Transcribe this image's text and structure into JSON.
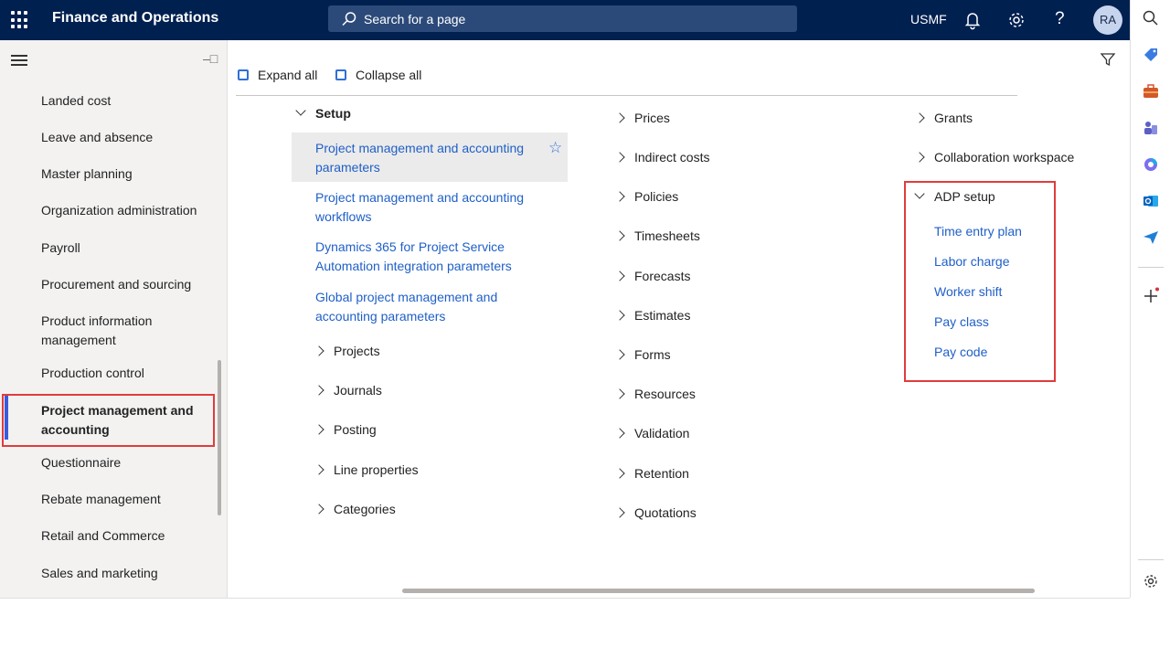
{
  "header": {
    "app_title": "Finance and Operations",
    "search_placeholder": "Search for a page",
    "company": "USMF",
    "avatar_initials": "RA",
    "help_label": "?"
  },
  "sidebar": {
    "items": [
      {
        "label": "Landed cost"
      },
      {
        "label": "Leave and absence"
      },
      {
        "label": "Master planning"
      },
      {
        "label": "Organization administration"
      },
      {
        "label": "Payroll"
      },
      {
        "label": "Procurement and sourcing"
      },
      {
        "label": "Product information management"
      },
      {
        "label": "Production control"
      },
      {
        "label": "Project management and accounting"
      },
      {
        "label": "Questionnaire"
      },
      {
        "label": "Rebate management"
      },
      {
        "label": "Retail and Commerce"
      },
      {
        "label": "Sales and marketing"
      }
    ],
    "active_item": "Project management and accounting"
  },
  "toolbar": {
    "expand_all": "Expand all",
    "collapse_all": "Collapse all"
  },
  "col1": {
    "setup_heading": "Setup",
    "setup_links": [
      {
        "label": "Project management and accounting parameters"
      },
      {
        "label": "Project management and accounting workflows"
      },
      {
        "label": "Dynamics 365 for Project Service Automation integration parameters"
      },
      {
        "label": "Global project management and accounting parameters"
      }
    ],
    "groups": [
      {
        "label": "Projects"
      },
      {
        "label": "Journals"
      },
      {
        "label": "Posting"
      },
      {
        "label": "Line properties"
      },
      {
        "label": "Categories"
      }
    ]
  },
  "col2": {
    "groups": [
      {
        "label": "Prices"
      },
      {
        "label": "Indirect costs"
      },
      {
        "label": "Policies"
      },
      {
        "label": "Timesheets"
      },
      {
        "label": "Forecasts"
      },
      {
        "label": "Estimates"
      },
      {
        "label": "Forms"
      },
      {
        "label": "Resources"
      },
      {
        "label": "Validation"
      },
      {
        "label": "Retention"
      },
      {
        "label": "Quotations"
      }
    ]
  },
  "col3": {
    "groups": [
      {
        "label": "Grants"
      },
      {
        "label": "Collaboration workspace"
      }
    ],
    "adp_heading": "ADP setup",
    "adp_links": [
      {
        "label": "Time entry plan"
      },
      {
        "label": "Labor charge"
      },
      {
        "label": "Worker shift"
      },
      {
        "label": "Pay class"
      },
      {
        "label": "Pay code"
      }
    ]
  },
  "colors": {
    "topbar": "#002050",
    "link": "#1f5fc7",
    "highlight_box": "#e03c3c"
  }
}
